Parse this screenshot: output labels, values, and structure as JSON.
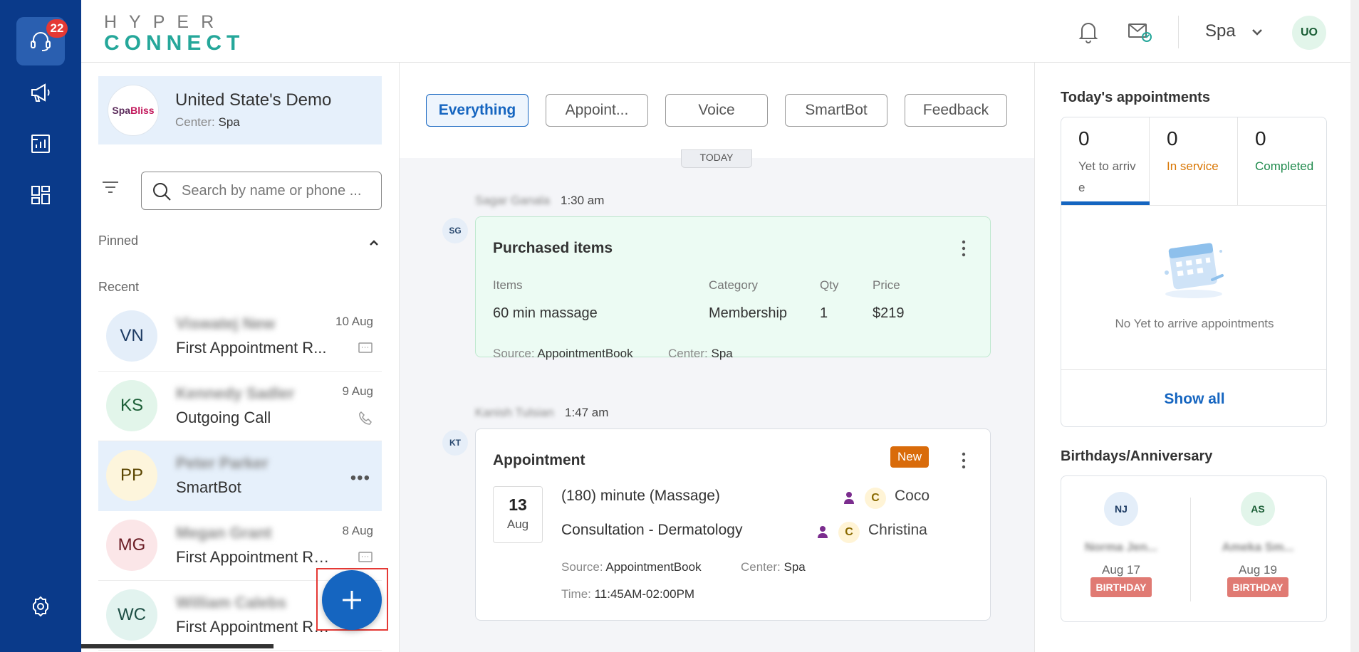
{
  "rail": {
    "badge_count": "22",
    "items": [
      "headset-icon",
      "megaphone-icon",
      "reports-icon",
      "apps-grid-icon",
      "settings-icon"
    ]
  },
  "header": {
    "logo_top": "HYPER",
    "logo_bottom": "CONNECT",
    "center_selector": "Spa",
    "user_initials": "UO"
  },
  "org": {
    "logo_text_a": "Spa",
    "logo_text_b": "Bliss",
    "name": "United State's Demo",
    "center_label": "Center:",
    "center_value": "Spa"
  },
  "search": {
    "placeholder": "Search by name or phone ..."
  },
  "sections": {
    "pinned": "Pinned",
    "recent": "Recent"
  },
  "conversations": [
    {
      "initials": "VN",
      "name": "Viswatej New",
      "subtitle": "First Appointment R...",
      "date": "10 Aug",
      "icon": "message-icon",
      "avatar_bg": "#e4eef9",
      "avatar_fg": "#1d3b63"
    },
    {
      "initials": "KS",
      "name": "Kennedy Sadler",
      "subtitle": "Outgoing Call",
      "date": "9 Aug",
      "icon": "phone-icon",
      "avatar_bg": "#e2f5ea",
      "avatar_fg": "#1b5e36"
    },
    {
      "initials": "PP",
      "name": "Peter Parker",
      "subtitle": "SmartBot",
      "date": "",
      "icon": "more-icon",
      "avatar_bg": "#fdf5dc",
      "avatar_fg": "#5a4500"
    },
    {
      "initials": "MG",
      "name": "Megan Grant",
      "subtitle": "First Appointment Re...",
      "date": "8 Aug",
      "icon": "message-icon",
      "avatar_bg": "#fbe6e8",
      "avatar_fg": "#6a1c24"
    },
    {
      "initials": "WC",
      "name": "William Calebs",
      "subtitle": "First Appointment Re...",
      "date": "",
      "icon": "",
      "avatar_bg": "#e2f3ef",
      "avatar_fg": "#1d4e44"
    }
  ],
  "fab": {
    "icon": "plus-icon"
  },
  "filters": [
    "Everything",
    "Appoint...",
    "Voice",
    "SmartBot",
    "Feedback"
  ],
  "today_pill": "TODAY",
  "timeline": {
    "purchase": {
      "author": "Sagar Ganala",
      "time": "1:30 am",
      "avatar": "SG",
      "title": "Purchased items",
      "headers": {
        "items": "Items",
        "category": "Category",
        "qty": "Qty",
        "price": "Price"
      },
      "row": {
        "item": "60 min massage",
        "category": "Membership",
        "qty": "1",
        "price": "$219"
      },
      "source_label": "Source:",
      "source_value": "AppointmentBook",
      "center_label": "Center:",
      "center_value": "Spa"
    },
    "appointment": {
      "author": "Kanish Tulsian",
      "time": "1:47 am",
      "avatar": "KT",
      "title": "Appointment",
      "badge": "New",
      "day": "13",
      "month": "Aug",
      "services": [
        {
          "name": "(180) minute (Massage)",
          "staff_initial": "C",
          "staff": "Coco"
        },
        {
          "name": "Consultation - Dermatology",
          "staff_initial": "C",
          "staff": "Christina"
        }
      ],
      "source_label": "Source:",
      "source_value": "AppointmentBook",
      "center_label": "Center:",
      "center_value": "Spa",
      "time_label": "Time:",
      "time_value": "11:45AM-02:00PM"
    }
  },
  "today_appointments": {
    "title": "Today's appointments",
    "stats": [
      {
        "count": "0",
        "label": "Yet to arrive",
        "color": "#666666"
      },
      {
        "count": "0",
        "label": "In service",
        "color": "#d97706"
      },
      {
        "count": "0",
        "label": "Completed",
        "color": "#1f8a4c"
      }
    ],
    "empty_text": "No Yet to arrive appointments",
    "show_all": "Show all"
  },
  "birthdays": {
    "title": "Birthdays/Anniversary",
    "people": [
      {
        "initials": "NJ",
        "name": "Norma Jen...",
        "date": "Aug 17",
        "tag": "BIRTHDAY",
        "avatar_bg": "#e4eef9",
        "avatar_fg": "#1d3b63"
      },
      {
        "initials": "AS",
        "name": "Ameka Sm...",
        "date": "Aug 19",
        "tag": "BIRTHDAY",
        "avatar_bg": "#e2f5ea",
        "avatar_fg": "#1b5e36"
      }
    ]
  }
}
